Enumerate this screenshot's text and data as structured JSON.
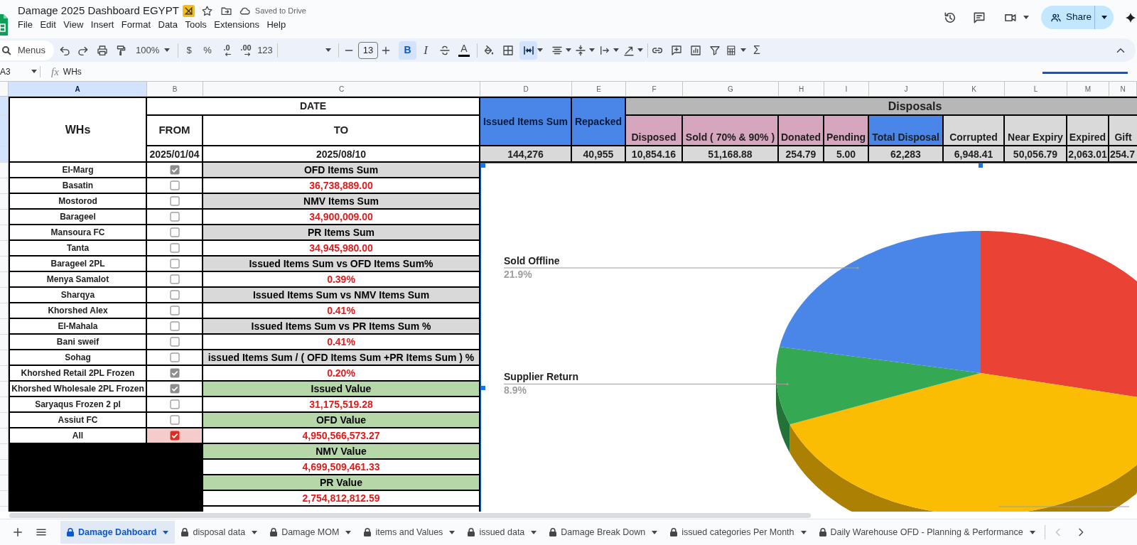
{
  "document": {
    "title": "Damage 2025 Dashboard EGYPT",
    "save_status": "Saved to Drive"
  },
  "menu": [
    "File",
    "Edit",
    "View",
    "Insert",
    "Format",
    "Data",
    "Tools",
    "Extensions",
    "Help"
  ],
  "share_button": {
    "label": "Share"
  },
  "toolbar": {
    "search_placeholder": "Menus",
    "zoom": "100%",
    "number_formats": [
      {
        "label": "$",
        "kind": "plain"
      },
      {
        "label": "%",
        "kind": "plain"
      },
      {
        "label": ".0",
        "kind": "decrease"
      },
      {
        "label": ".00",
        "kind": "increase"
      },
      {
        "label": "123",
        "kind": "plain"
      }
    ],
    "font_size": "13",
    "text_styles": [
      {
        "label": "B",
        "kind": "bold",
        "selected": true
      },
      {
        "label": "I",
        "kind": "italic",
        "selected": false
      }
    ],
    "text_color_label": "A",
    "merge_selected": true,
    "sum_label": "Σ"
  },
  "formula_bar": {
    "cell": "A3",
    "label": "fx",
    "content": "WHs"
  },
  "sheet": {
    "columns": [
      {
        "letter": "A",
        "selected": true
      },
      {
        "letter": "B",
        "selected": false
      },
      {
        "letter": "C",
        "selected": false
      },
      {
        "letter": "D",
        "selected": false
      },
      {
        "letter": "E",
        "selected": false
      },
      {
        "letter": "F",
        "selected": false
      },
      {
        "letter": "G",
        "selected": false
      },
      {
        "letter": "H",
        "selected": false
      },
      {
        "letter": "I",
        "selected": false
      },
      {
        "letter": "J",
        "selected": false
      },
      {
        "letter": "K",
        "selected": false
      },
      {
        "letter": "L",
        "selected": false
      },
      {
        "letter": "M",
        "selected": false
      },
      {
        "letter": "N",
        "selected": false
      }
    ],
    "row_headers": [
      {
        "selected": true
      },
      {
        "selected": true
      },
      {
        "selected": true
      },
      {
        "selected": false
      },
      {
        "selected": false
      },
      {
        "selected": false
      },
      {
        "selected": false
      },
      {
        "selected": false
      },
      {
        "selected": false
      },
      {
        "selected": false
      },
      {
        "selected": false
      },
      {
        "selected": false
      },
      {
        "selected": false
      },
      {
        "selected": false
      },
      {
        "selected": false
      },
      {
        "selected": false
      },
      {
        "selected": false
      },
      {
        "selected": false
      },
      {
        "selected": false
      },
      {
        "selected": false
      },
      {
        "selected": false
      },
      {
        "selected": false
      },
      {
        "selected": false
      },
      {
        "selected": false
      },
      {
        "selected": false
      }
    ],
    "header": {
      "warehouse": "WHs",
      "date": "DATE",
      "from": "FROM",
      "to": "TO",
      "from_value": "2025/01/04",
      "to_value": "2025/08/10"
    },
    "totals": [
      {
        "label": "Issued Items Sum",
        "value": "144,276"
      },
      {
        "label": "Repacked",
        "value": "40,955"
      }
    ],
    "disposals": {
      "title": "Disposals",
      "columns": [
        {
          "label": "Disposed",
          "value": "10,854.16",
          "kind": "disposal"
        },
        {
          "label": "Sold ( 70% & 90% )",
          "value": "51,168.88",
          "kind": "disposal"
        },
        {
          "label": "Donated",
          "value": "254.79",
          "kind": "disposal"
        },
        {
          "label": "Pending",
          "value": "5.00",
          "kind": "disposal"
        },
        {
          "label": "Total Disposal",
          "value": "62,283",
          "kind": "total"
        },
        {
          "label": "Corrupted",
          "value": "6,948.41",
          "kind": "reason"
        },
        {
          "label": "Near Expiry",
          "value": "50,056.79",
          "kind": "reason"
        },
        {
          "label": "Expired",
          "value": "2,063.01",
          "kind": "reason"
        },
        {
          "label": "Gift",
          "value": "254.7",
          "kind": "reason"
        }
      ]
    },
    "warehouses": [
      {
        "name": "El-Marg",
        "checked": true,
        "highlighted": false
      },
      {
        "name": "Basatin",
        "checked": false,
        "highlighted": false
      },
      {
        "name": "Mostorod",
        "checked": false,
        "highlighted": false
      },
      {
        "name": "Barageel",
        "checked": false,
        "highlighted": false
      },
      {
        "name": "Mansoura FC",
        "checked": false,
        "highlighted": false
      },
      {
        "name": "Tanta",
        "checked": false,
        "highlighted": false
      },
      {
        "name": "Barageel 2PL",
        "checked": false,
        "highlighted": false
      },
      {
        "name": "Menya Samalot",
        "checked": false,
        "highlighted": false
      },
      {
        "name": "Sharqya",
        "checked": false,
        "highlighted": false
      },
      {
        "name": "Khorshed Alex",
        "checked": false,
        "highlighted": false
      },
      {
        "name": "El-Mahala",
        "checked": false,
        "highlighted": false
      },
      {
        "name": "Bani sweif",
        "checked": false,
        "highlighted": false
      },
      {
        "name": "Sohag",
        "checked": false,
        "highlighted": false
      },
      {
        "name": "Khorshed Retail 2PL Frozen",
        "checked": true,
        "highlighted": false
      },
      {
        "name": "Khorshed Wholesale 2PL Frozen",
        "checked": true,
        "highlighted": false
      },
      {
        "name": "Saryaqus Frozen 2 pl",
        "checked": false,
        "highlighted": false
      },
      {
        "name": "Assiut FC",
        "checked": false,
        "highlighted": false
      },
      {
        "name": "All",
        "checked": true,
        "highlighted": true
      }
    ],
    "metrics": [
      {
        "text": "OFD Items Sum",
        "kind": "count_label"
      },
      {
        "text": "36,738,889.00",
        "kind": "figure"
      },
      {
        "text": "NMV Items Sum",
        "kind": "count_label"
      },
      {
        "text": "34,900,009.00",
        "kind": "figure"
      },
      {
        "text": "PR Items Sum",
        "kind": "count_label"
      },
      {
        "text": "34,945,980.00",
        "kind": "figure"
      },
      {
        "text": "Issued Items Sum vs OFD Items Sum%",
        "kind": "count_label"
      },
      {
        "text": "0.39%",
        "kind": "figure"
      },
      {
        "text": "Issued Items Sum vs NMV Items Sum",
        "kind": "count_label"
      },
      {
        "text": "0.41%",
        "kind": "figure"
      },
      {
        "text": "Issued Items Sum vs PR Items Sum %",
        "kind": "count_label"
      },
      {
        "text": "0.41%",
        "kind": "figure"
      },
      {
        "text": "issued Items Sum / ( OFD Items Sum +PR Items Sum ) %",
        "kind": "count_label"
      },
      {
        "text": "0.20%",
        "kind": "figure"
      },
      {
        "text": "Issued Value",
        "kind": "value_label"
      },
      {
        "text": "31,175,519.28",
        "kind": "figure"
      },
      {
        "text": "OFD Value",
        "kind": "value_label"
      },
      {
        "text": "4,950,566,573.27",
        "kind": "figure"
      },
      {
        "text": "NMV Value",
        "kind": "value_label"
      },
      {
        "text": "4,699,509,461.33",
        "kind": "figure"
      },
      {
        "text": "PR Value",
        "kind": "value_label"
      },
      {
        "text": "2,754,812,812.59",
        "kind": "figure"
      }
    ]
  },
  "chart": {
    "callouts": [
      {
        "label": "Sold Offline",
        "share": "21.9%"
      },
      {
        "label": "Supplier Return",
        "share": "8.9%"
      }
    ],
    "slices": [
      {
        "color": "#ea4335"
      },
      {
        "color": "#fbbc04"
      },
      {
        "color": "#34a853"
      },
      {
        "color": "#4a86e8"
      }
    ]
  },
  "sheet_tabs": [
    {
      "label": "Damage Dahboard",
      "selected": true
    },
    {
      "label": "disposal data",
      "selected": false
    },
    {
      "label": "Damage MOM",
      "selected": false
    },
    {
      "label": "items and Values",
      "selected": false
    },
    {
      "label": "issued data",
      "selected": false
    },
    {
      "label": "Damage Break Down",
      "selected": false
    },
    {
      "label": "issued categories Per Month",
      "selected": false
    },
    {
      "label": "Daily Warehouse OFD - Planning & Performance",
      "selected": false
    }
  ],
  "tab_scroll": {
    "left_disabled": true,
    "right_disabled": false
  }
}
